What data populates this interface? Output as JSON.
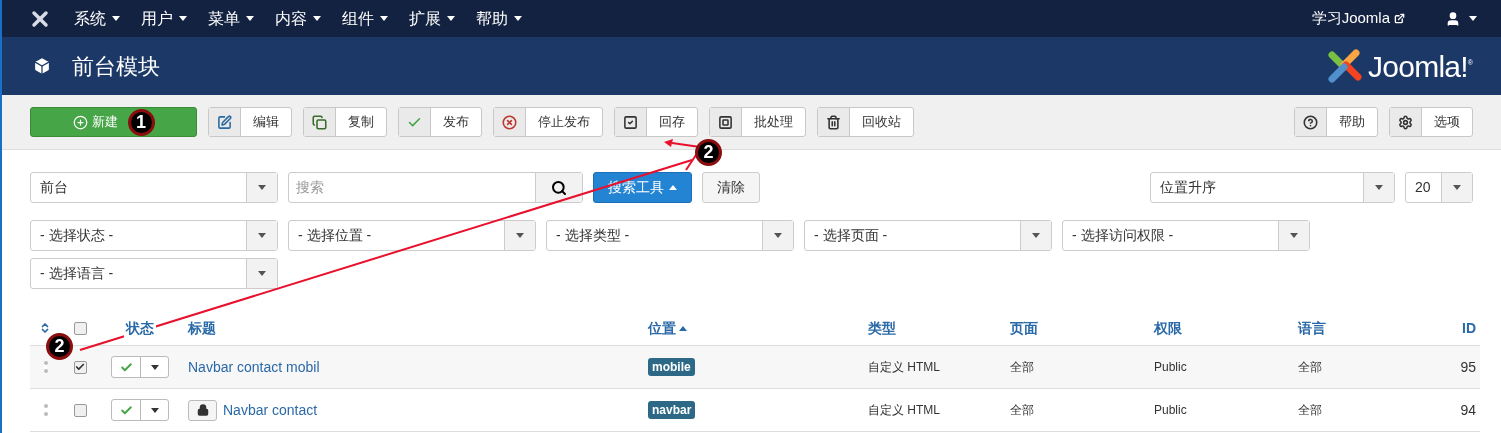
{
  "top_menu": {
    "items": [
      "系统",
      "用户",
      "菜单",
      "内容",
      "组件",
      "扩展",
      "帮助"
    ],
    "site_link": "学习Joomla"
  },
  "header": {
    "title": "前台模块",
    "logo_text": "Joomla!",
    "logo_mark": "®"
  },
  "toolbar": {
    "left": [
      {
        "kind": "primary",
        "label": "新建"
      },
      {
        "kind": "default",
        "label": "编辑"
      },
      {
        "kind": "default",
        "label": "复制"
      },
      {
        "kind": "default",
        "label": "发布"
      },
      {
        "kind": "default",
        "label": "停止发布"
      },
      {
        "kind": "default",
        "label": "回存"
      },
      {
        "kind": "default",
        "label": "批处理"
      },
      {
        "kind": "default",
        "label": "回收站"
      }
    ],
    "right": [
      {
        "kind": "default",
        "label": "帮助"
      },
      {
        "kind": "default",
        "label": "选项"
      }
    ]
  },
  "filters": {
    "client": "前台",
    "search_placeholder": "搜索",
    "search_tools": "搜索工具",
    "clear": "清除",
    "ordering": "位置升序",
    "limit": "20",
    "selects": [
      "- 选择状态 -",
      "- 选择位置 -",
      "- 选择类型 -",
      "- 选择页面 -",
      "- 选择访问权限 -",
      "- 选择语言 -"
    ]
  },
  "table": {
    "all_checked": false,
    "columns": [
      "状态",
      "标题",
      "位置",
      "类型",
      "页面",
      "权限",
      "语言",
      "ID"
    ],
    "rows": [
      {
        "checked": true,
        "published": true,
        "locked": false,
        "title": "Navbar contact mobil",
        "position": "mobile",
        "type": "自定义 HTML",
        "pages": "全部",
        "access": "Public",
        "language": "全部",
        "id": "95"
      },
      {
        "checked": false,
        "published": true,
        "locked": true,
        "title": "Navbar contact",
        "position": "navbar",
        "type": "自定义 HTML",
        "pages": "全部",
        "access": "Public",
        "language": "全部",
        "id": "94"
      }
    ]
  },
  "annotations": [
    "1",
    "2",
    "2"
  ]
}
